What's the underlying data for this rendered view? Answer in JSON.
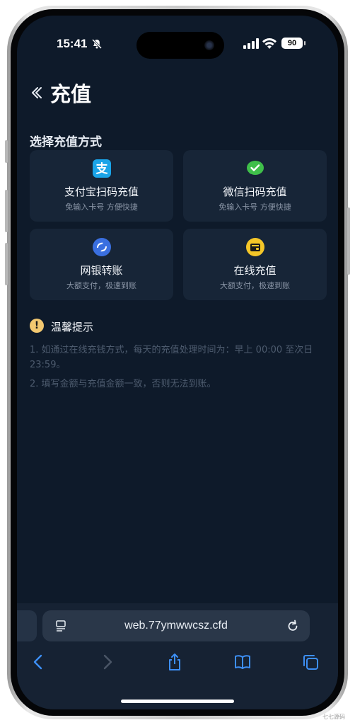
{
  "status_bar": {
    "time": "15:41",
    "battery": "90",
    "icons": [
      "bell-slash-icon",
      "cellular-signal-icon",
      "wifi-icon",
      "battery-icon"
    ]
  },
  "header": {
    "title": "充值",
    "back_icon": "chevron-left-double-icon"
  },
  "section_title": "选择充值方式",
  "payment_methods": [
    {
      "title": "支付宝扫码充值",
      "subtitle": "免输入卡号 方便快捷",
      "icon": "alipay-icon",
      "icon_color": "#1aa4e8"
    },
    {
      "title": "微信扫码充值",
      "subtitle": "免输入卡号 方便快捷",
      "icon": "wechat-icon",
      "icon_color": "#3fbf4a"
    },
    {
      "title": "网银转账",
      "subtitle": "大额支付，极速到账",
      "icon": "bank-transfer-icon",
      "icon_color": "#3a6fe0"
    },
    {
      "title": "在线充值",
      "subtitle": "大额支付，极速到账",
      "icon": "wallet-icon",
      "icon_color": "#f4c628"
    }
  ],
  "tips": {
    "icon_text": "!",
    "heading": "温馨提示",
    "items": [
      "1. 如通过在线充钱方式，每天的充值处理时间为：早上 00:00 至次日 23:59。",
      "2. 填写金额与充值金额一致，否则无法到账。"
    ]
  },
  "browser": {
    "url": "web.77ymwwcsz.cfd",
    "toolbar_icons": [
      "back-arrow-icon",
      "forward-arrow-icon",
      "share-icon",
      "bookmarks-icon",
      "tabs-icon"
    ],
    "accent": "#3d8ff5"
  },
  "colors": {
    "background": "#0e1a2a",
    "card": "#172537",
    "tip_text": "#4d5b6e"
  },
  "watermark": "七七源码"
}
